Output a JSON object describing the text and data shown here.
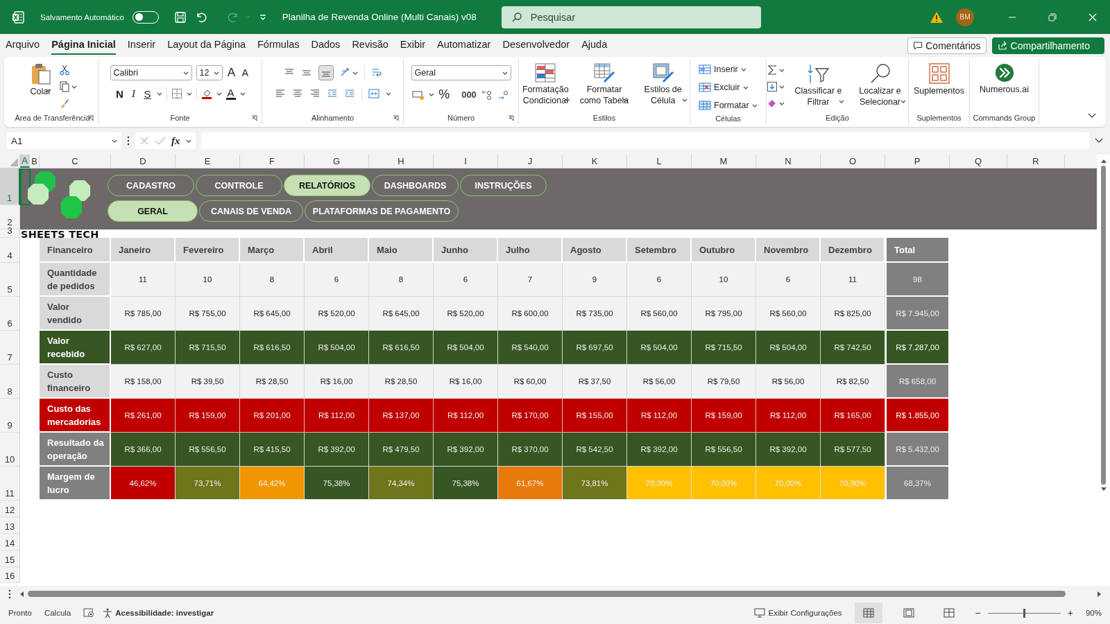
{
  "title_bar": {
    "autosave_label": "Salvamento Automático",
    "autosave_on": false,
    "document_title": "Planilha de Revenda Online (Multi Canais) v08",
    "search_placeholder": "Pesquisar",
    "avatar": "BM"
  },
  "menu_tabs": [
    {
      "label": "Arquivo",
      "selected": false
    },
    {
      "label": "Página Inicial",
      "selected": true
    },
    {
      "label": "Inserir",
      "selected": false
    },
    {
      "label": "Layout da Página",
      "selected": false
    },
    {
      "label": "Fórmulas",
      "selected": false
    },
    {
      "label": "Dados",
      "selected": false
    },
    {
      "label": "Revisão",
      "selected": false
    },
    {
      "label": "Exibir",
      "selected": false
    },
    {
      "label": "Automatizar",
      "selected": false
    },
    {
      "label": "Desenvolvedor",
      "selected": false
    },
    {
      "label": "Ajuda",
      "selected": false
    }
  ],
  "top_buttons": {
    "comments": "Comentários",
    "share": "Compartilhamento"
  },
  "ribbon": {
    "clipboard": {
      "label": "Área de Transferência",
      "paste": "Colar"
    },
    "font": {
      "label": "Fonte",
      "family": "Calibri",
      "size": "12",
      "grow": "A",
      "shrink": "A",
      "bold": "N",
      "italic": "I",
      "underline": "S",
      "color_letter": "A"
    },
    "alignment": {
      "label": "Alinhamento"
    },
    "number": {
      "label": "Número",
      "format": "Geral",
      "percent": "%",
      "thousands": "000"
    },
    "styles": {
      "label": "Estilos",
      "buttons": [
        "Formatação Condicional",
        "Formatar como Tabela",
        "Estilos de Célula"
      ]
    },
    "cells": {
      "label": "Células",
      "buttons": [
        "Inserir",
        "Excluir",
        "Formatar"
      ]
    },
    "editing": {
      "label": "Edição",
      "buttons": [
        "Classificar e Filtrar",
        "Localizar e Selecionar"
      ]
    },
    "addins": {
      "label": "Suplementos",
      "button": "Suplementos"
    },
    "commands": {
      "label": "Commands Group",
      "button": "Numerous.ai"
    }
  },
  "formula_bar": {
    "name_box": "A1",
    "fx": "fx"
  },
  "sheet": {
    "columns": [
      {
        "label": "A",
        "selected": true
      },
      {
        "label": "B",
        "selected": false
      },
      {
        "label": "C",
        "selected": false
      },
      {
        "label": "D",
        "selected": false
      },
      {
        "label": "E",
        "selected": false
      },
      {
        "label": "F",
        "selected": false
      },
      {
        "label": "G",
        "selected": false
      },
      {
        "label": "H",
        "selected": false
      },
      {
        "label": "I",
        "selected": false
      },
      {
        "label": "J",
        "selected": false
      },
      {
        "label": "K",
        "selected": false
      },
      {
        "label": "L",
        "selected": false
      },
      {
        "label": "M",
        "selected": false
      },
      {
        "label": "N",
        "selected": false
      },
      {
        "label": "O",
        "selected": false
      },
      {
        "label": "P",
        "selected": false
      },
      {
        "label": "Q",
        "selected": false
      },
      {
        "label": "R",
        "selected": false
      }
    ],
    "rows": [
      {
        "label": "1",
        "selected": true
      },
      {
        "label": "2",
        "selected": false
      },
      {
        "label": "3",
        "selected": false
      },
      {
        "label": "4",
        "selected": false
      },
      {
        "label": "5",
        "selected": false
      },
      {
        "label": "6",
        "selected": false
      },
      {
        "label": "7",
        "selected": false
      },
      {
        "label": "8",
        "selected": false
      },
      {
        "label": "9",
        "selected": false
      },
      {
        "label": "10",
        "selected": false
      },
      {
        "label": "11",
        "selected": false
      },
      {
        "label": "12",
        "selected": false
      },
      {
        "label": "13",
        "selected": false
      },
      {
        "label": "14",
        "selected": false
      },
      {
        "label": "15",
        "selected": false
      },
      {
        "label": "16",
        "selected": false
      }
    ],
    "nav_tabs": [
      {
        "label": "CADASTRO",
        "selected": false
      },
      {
        "label": "CONTROLE",
        "selected": false
      },
      {
        "label": "RELATÓRIOS",
        "selected": true
      },
      {
        "label": "DASHBOARDS",
        "selected": false
      },
      {
        "label": "INSTRUÇÕES",
        "selected": false
      }
    ],
    "sub_tabs": [
      {
        "label": "GERAL",
        "selected": true
      },
      {
        "label": "CANAIS DE VENDA",
        "selected": false
      },
      {
        "label": "PLATAFORMAS DE PAGAMENTO",
        "selected": false
      }
    ],
    "logo_text": "SHEETS TECH",
    "table": {
      "header": [
        "Financeiro",
        "Janeiro",
        "Fevereiro",
        "Março",
        "Abril",
        "Maio",
        "Junho",
        "Julho",
        "Agosto",
        "Setembro",
        "Outubro",
        "Novembro",
        "Dezembro",
        "Total"
      ],
      "rows": [
        {
          "label": "Quantidade de pedidos",
          "kind": "light",
          "cells": [
            "11",
            "10",
            "8",
            "6",
            "8",
            "6",
            "7",
            "9",
            "6",
            "10",
            "6",
            "11"
          ],
          "total": "98"
        },
        {
          "label": "Valor vendido",
          "kind": "light",
          "cells": [
            "R$ 785,00",
            "R$ 755,00",
            "R$ 645,00",
            "R$ 520,00",
            "R$ 645,00",
            "R$ 520,00",
            "R$ 600,00",
            "R$ 735,00",
            "R$ 560,00",
            "R$ 795,00",
            "R$ 560,00",
            "R$ 825,00"
          ],
          "total": "R$ 7.945,00"
        },
        {
          "label": "Valor recebido",
          "kind": "received",
          "cells": [
            "R$ 627,00",
            "R$ 715,50",
            "R$ 616,50",
            "R$ 504,00",
            "R$ 616,50",
            "R$ 504,00",
            "R$ 540,00",
            "R$ 697,50",
            "R$ 504,00",
            "R$ 715,50",
            "R$ 504,00",
            "R$ 742,50"
          ],
          "total": "R$ 7.287,00"
        },
        {
          "label": "Custo financeiro",
          "kind": "light",
          "cells": [
            "R$ 158,00",
            "R$ 39,50",
            "R$ 28,50",
            "R$ 16,00",
            "R$ 28,50",
            "R$ 16,00",
            "R$ 60,00",
            "R$ 37,50",
            "R$ 56,00",
            "R$ 79,50",
            "R$ 56,00",
            "R$ 82,50"
          ],
          "total": "R$ 658,00"
        },
        {
          "label": "Custo das mercadorias",
          "kind": "cost",
          "cells": [
            "R$ 261,00",
            "R$ 159,00",
            "R$ 201,00",
            "R$ 112,00",
            "R$ 137,00",
            "R$ 112,00",
            "R$ 170,00",
            "R$ 155,00",
            "R$ 112,00",
            "R$ 159,00",
            "R$ 112,00",
            "R$ 165,00"
          ],
          "total": "R$ 1.855,00"
        },
        {
          "label": "Resultado da operação",
          "kind": "result",
          "cells": [
            "R$ 366,00",
            "R$ 556,50",
            "R$ 415,50",
            "R$ 392,00",
            "R$ 479,50",
            "R$ 392,00",
            "R$ 370,00",
            "R$ 542,50",
            "R$ 392,00",
            "R$ 556,50",
            "R$ 392,00",
            "R$ 577,50"
          ],
          "total": "R$ 5.432,00"
        },
        {
          "label": "Margem de lucro",
          "kind": "margin",
          "cells": [
            {
              "value": "46,62%",
              "color": "#c00000"
            },
            {
              "value": "73,71%",
              "color": "#6f751b"
            },
            {
              "value": "64,42%",
              "color": "#ef9600"
            },
            {
              "value": "75,38%",
              "color": "#375623"
            },
            {
              "value": "74,34%",
              "color": "#6f751b"
            },
            {
              "value": "75,38%",
              "color": "#375623"
            },
            {
              "value": "61,67%",
              "color": "#e87a0c"
            },
            {
              "value": "73,81%",
              "color": "#6f751b"
            },
            {
              "value": "70,00%",
              "color": "#ffc000"
            },
            {
              "value": "70,00%",
              "color": "#ffc000"
            },
            {
              "value": "70,00%",
              "color": "#ffc000"
            },
            {
              "value": "70,00%",
              "color": "#ffc000"
            }
          ],
          "total": "68,37%"
        }
      ]
    }
  },
  "status_bar": {
    "ready": "Pronto",
    "calc": "Calcula",
    "accessibility": "Acessibilidade: investigar",
    "display_settings": "Exibir Configurações",
    "zoom": "90%",
    "zoom_out": "−",
    "zoom_in": "+",
    "zoom_slider": {
      "level": 0.5
    }
  }
}
